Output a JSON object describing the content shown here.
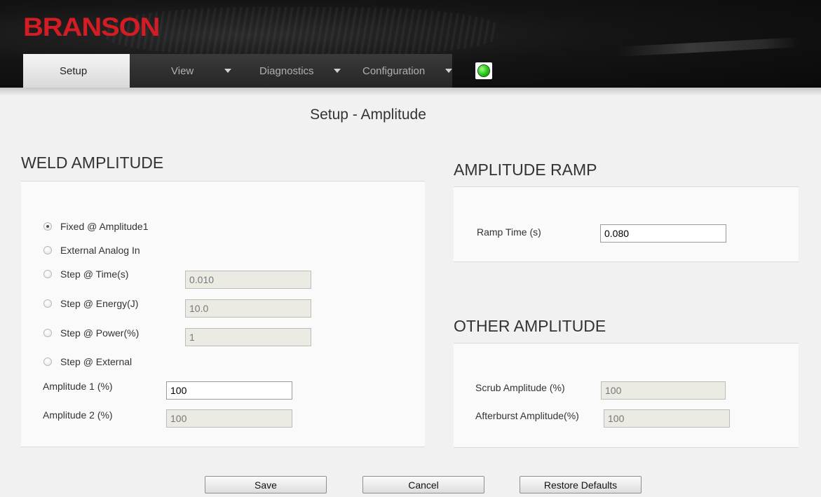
{
  "header": {
    "logo": "BRANSON",
    "nav": [
      {
        "label": "Setup"
      },
      {
        "label": "View"
      },
      {
        "label": "Diagnostics"
      },
      {
        "label": "Configuration"
      }
    ],
    "status_color": "#22c414"
  },
  "page_title": "Setup - Amplitude",
  "weld_amplitude": {
    "title": "WELD AMPLITUDE",
    "options": [
      {
        "label": "Fixed @ Amplitude1",
        "checked": true
      },
      {
        "label": "External Analog In",
        "checked": false
      },
      {
        "label": "Step @ Time(s)",
        "checked": false,
        "value": "0.010"
      },
      {
        "label": "Step @ Energy(J)",
        "checked": false,
        "value": "10.0"
      },
      {
        "label": "Step @ Power(%)",
        "checked": false,
        "value": "1"
      },
      {
        "label": "Step @ External",
        "checked": false
      }
    ],
    "amplitude1_label": "Amplitude 1 (%)",
    "amplitude1_value": "100",
    "amplitude2_label": "Amplitude 2 (%)",
    "amplitude2_value": "100"
  },
  "amplitude_ramp": {
    "title": "AMPLITUDE RAMP",
    "ramp_time_label": "Ramp Time (s)",
    "ramp_time_value": "0.080"
  },
  "other_amplitude": {
    "title": "OTHER AMPLITUDE",
    "scrub_label": "Scrub Amplitude (%)",
    "scrub_value": "100",
    "afterburst_label": "Afterburst Amplitude(%)",
    "afterburst_value": "100"
  },
  "buttons": {
    "save": "Save",
    "cancel": "Cancel",
    "restore": "Restore Defaults"
  }
}
